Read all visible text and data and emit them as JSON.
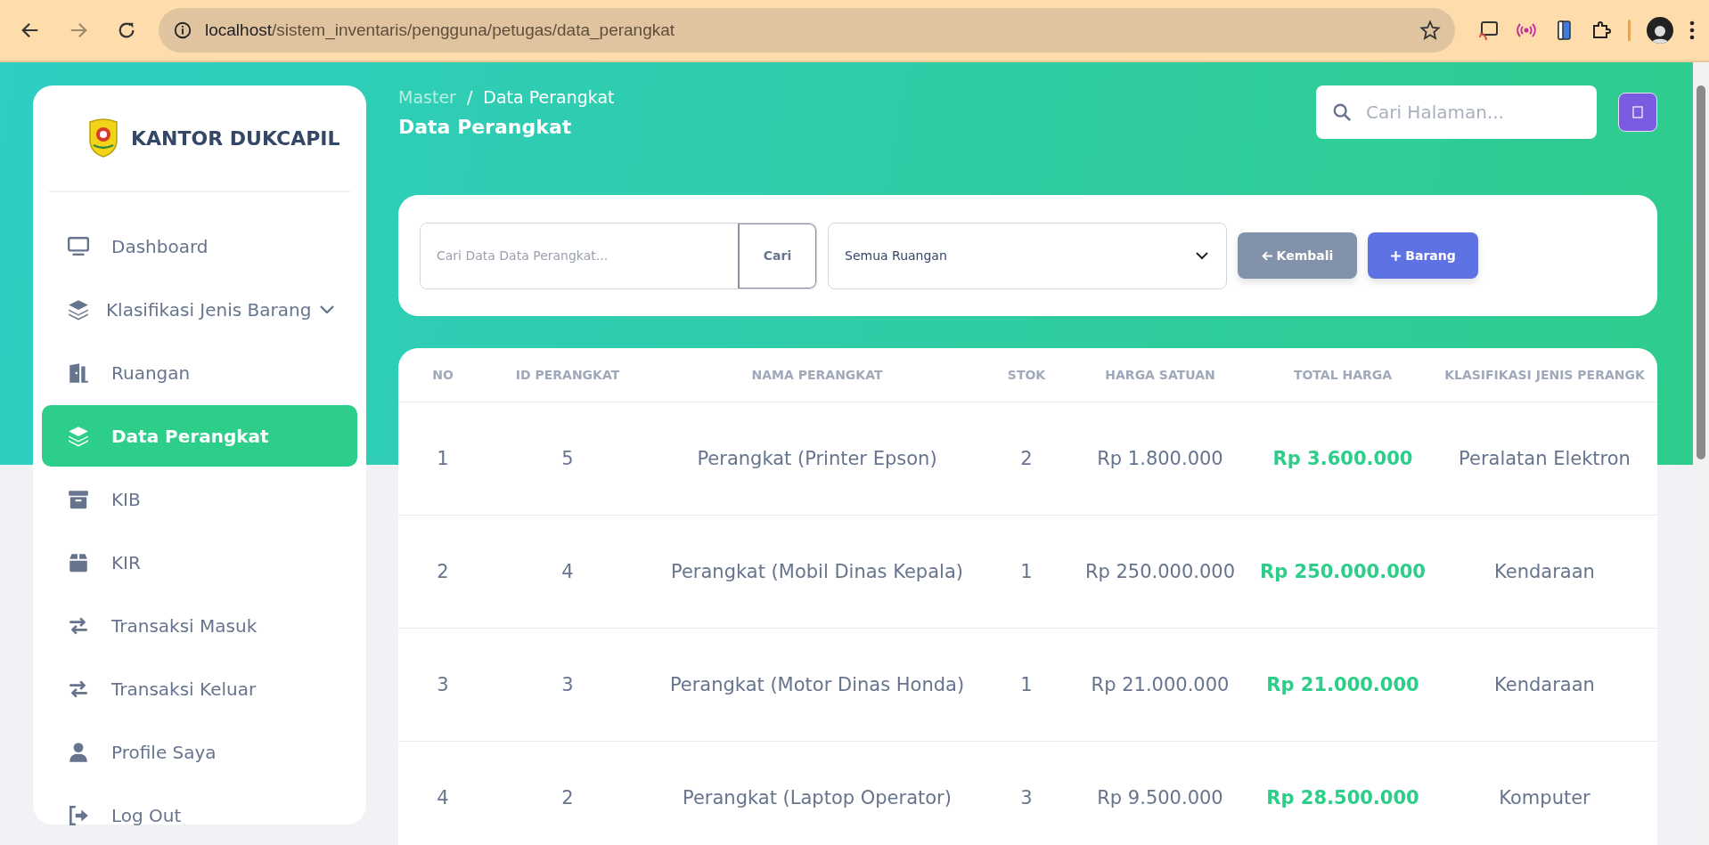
{
  "browser": {
    "url_host": "localhost",
    "url_path": "/sistem_inventaris/pengguna/petugas/data_perangkat"
  },
  "sidebar": {
    "brand": "KANTOR DUKCAPIL",
    "items": [
      {
        "label": "Dashboard",
        "kind": "monitor",
        "selected": false,
        "expandable": false
      },
      {
        "label": "Klasifikasi Jenis Barang",
        "kind": "layers",
        "selected": false,
        "expandable": true
      },
      {
        "label": "Ruangan",
        "kind": "door",
        "selected": false,
        "expandable": false
      },
      {
        "label": "Data Perangkat",
        "kind": "layers",
        "selected": true,
        "expandable": false
      },
      {
        "label": "KIB",
        "kind": "archive",
        "selected": false,
        "expandable": false
      },
      {
        "label": "KIR",
        "kind": "box",
        "selected": false,
        "expandable": false
      },
      {
        "label": "Transaksi Masuk",
        "kind": "swap",
        "selected": false,
        "expandable": false
      },
      {
        "label": "Transaksi Keluar",
        "kind": "swap",
        "selected": false,
        "expandable": false
      },
      {
        "label": "Profile Saya",
        "kind": "user",
        "selected": false,
        "expandable": false
      },
      {
        "label": "Log Out",
        "kind": "logout",
        "selected": false,
        "expandable": false
      }
    ]
  },
  "breadcrumb": {
    "items": [
      "Master",
      "Data Perangkat"
    ],
    "separator": "/"
  },
  "page_title": "Data Perangkat",
  "page_search": {
    "placeholder": "Cari Halaman..."
  },
  "filters": {
    "search_placeholder": "Cari Data Data Perangkat...",
    "search_button": "Cari",
    "room_select": "Semua Ruangan",
    "buttons": [
      {
        "label": "Kembali",
        "kind": "back"
      },
      {
        "label": "Barang",
        "kind": "add"
      }
    ]
  },
  "table": {
    "columns": [
      {
        "label": "NO",
        "highlight": false
      },
      {
        "label": "ID PERANGKAT",
        "highlight": false
      },
      {
        "label": "NAMA PERANGKAT",
        "highlight": false
      },
      {
        "label": "STOK",
        "highlight": false
      },
      {
        "label": "HARGA SATUAN",
        "highlight": false
      },
      {
        "label": "TOTAL HARGA",
        "highlight": true
      },
      {
        "label": "KLASIFIKASI JENIS PERANGK",
        "highlight": false
      }
    ],
    "rows": [
      [
        "1",
        "5",
        "Perangkat (Printer Epson)",
        "2",
        "Rp 1.800.000",
        "Rp 3.600.000",
        "Peralatan Elektron"
      ],
      [
        "2",
        "4",
        "Perangkat (Mobil Dinas Kepala)",
        "1",
        "Rp 250.000.000",
        "Rp 250.000.000",
        "Kendaraan"
      ],
      [
        "3",
        "3",
        "Perangkat (Motor Dinas Honda)",
        "1",
        "Rp 21.000.000",
        "Rp 21.000.000",
        "Kendaraan"
      ],
      [
        "4",
        "2",
        "Perangkat (Laptop Operator)",
        "3",
        "Rp 9.500.000",
        "Rp 28.500.000",
        "Komputer"
      ]
    ]
  }
}
